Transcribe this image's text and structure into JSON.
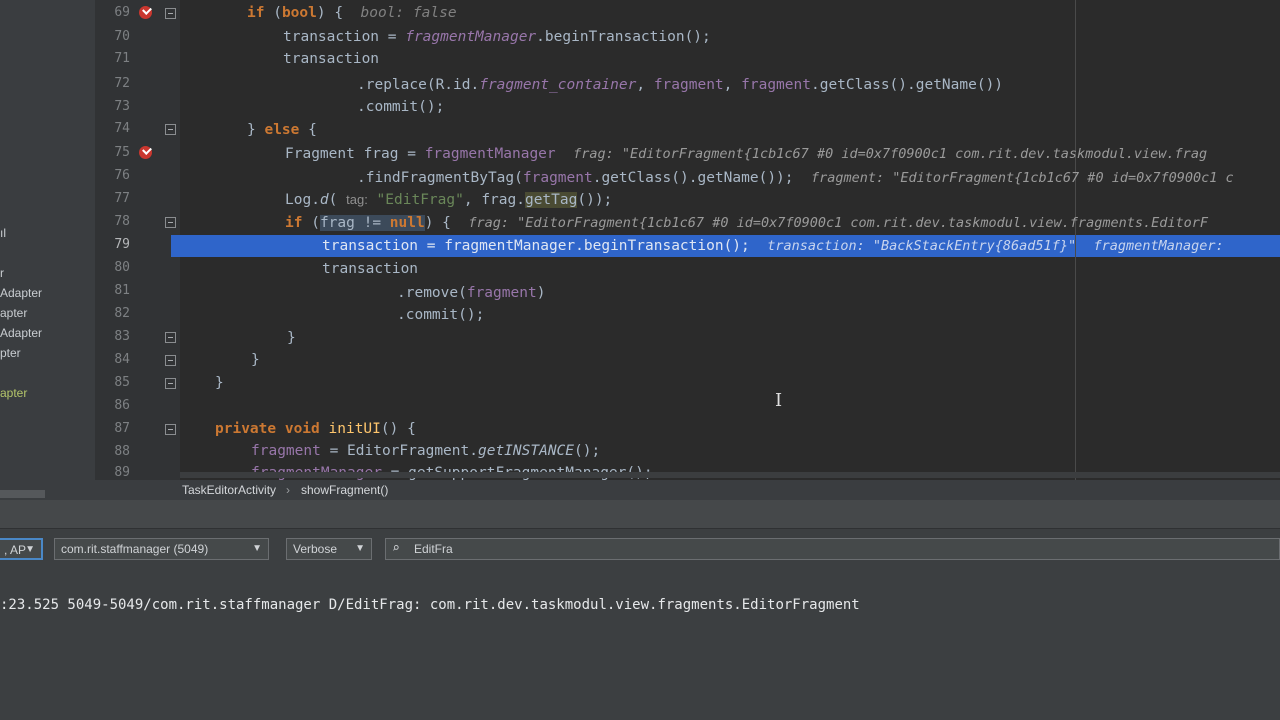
{
  "project_panel": {
    "items": [
      {
        "label": "ıl"
      },
      {
        "label": "r"
      },
      {
        "label": "Adapter"
      },
      {
        "label": "apter"
      },
      {
        "label": "Adapter"
      },
      {
        "label": "pter"
      },
      {
        "label": "apter"
      }
    ]
  },
  "editor": {
    "line_numbers": [
      "69",
      "70",
      "71",
      "72",
      "73",
      "74",
      "75",
      "76",
      "77",
      "78",
      "79",
      "80",
      "81",
      "82",
      "83",
      "84",
      "85",
      "86",
      "87",
      "88",
      "89"
    ],
    "current_line": "79",
    "breakpoint_lines": [
      "69",
      "75"
    ],
    "hints": {
      "l69": "bool: false",
      "l75": "frag: \"EditorFragment{1cb1c67 #0 id=0x7f0900c1 com.rit.dev.taskmodul.view.frag",
      "l76": "fragment: \"EditorFragment{1cb1c67 #0 id=0x7f0900c1 c",
      "l77_param": "tag:",
      "l78": "frag: \"EditorFragment{1cb1c67 #0 id=0x7f0900c1 com.rit.dev.taskmodul.view.fragments.EditorF",
      "l79a": "transaction: \"BackStackEntry{86ad51f}\"",
      "l79b": "fragmentManager:"
    }
  },
  "breadcrumb": {
    "items": [
      "TaskEditorActivity",
      "showFragment()"
    ],
    "separator": "›"
  },
  "logcat": {
    "device_label": ", AP",
    "process_label": "com.rit.staffmanager",
    "process_pid": "(5049)",
    "level_label": "Verbose",
    "search_value": "EditFra",
    "log_line": ":23.525 5049-5049/com.rit.staffmanager D/EditFrag: com.rit.dev.taskmodul.view.fragments.EditorFragment"
  },
  "colors": {
    "background": "#2b2b2b",
    "keyword": "#cc7832",
    "method": "#ffc66d",
    "field": "#9876aa",
    "string": "#6a8759",
    "execution_line": "#2f65ca",
    "breakpoint": "#c9372f"
  },
  "icons": [
    "breakpoint-icon",
    "fold-icon",
    "search-icon",
    "dropdown-arrow-icon",
    "text-cursor-icon"
  ]
}
